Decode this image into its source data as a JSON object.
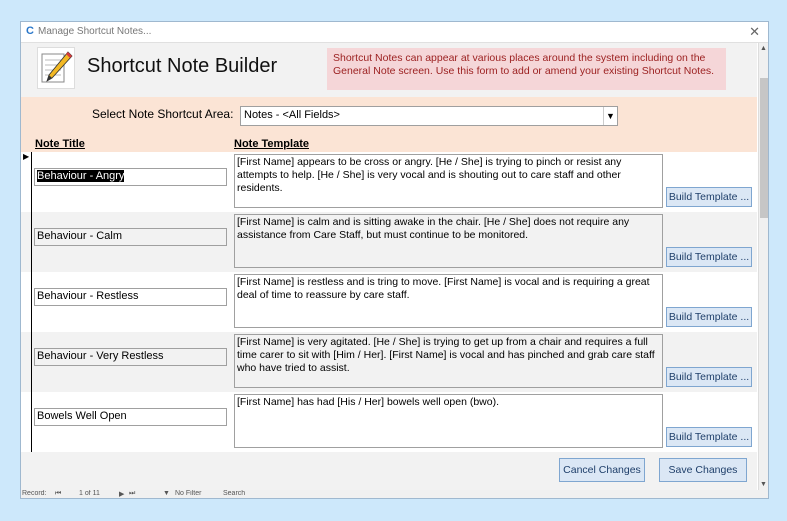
{
  "window": {
    "title": "Manage Shortcut Notes..."
  },
  "header": {
    "title": "Shortcut Note Builder",
    "note": "Shortcut Notes can appear at various places around the system including on the General Note screen.  Use this form to add or amend your existing Shortcut Notes."
  },
  "filter": {
    "label": "Select Note Shortcut Area:",
    "value": "Notes - <All Fields>"
  },
  "columns": {
    "title": "Note Title",
    "template": "Note Template"
  },
  "rows": [
    {
      "title": "Behaviour - Angry",
      "template": "[First Name] appears to be cross or angry. [He / She] is trying to pinch or resist any attempts to help. [He / She] is very vocal and is shouting out to care staff and other residents.",
      "button": "Build Template ..."
    },
    {
      "title": "Behaviour - Calm",
      "template": "[First Name] is calm and is sitting awake in the chair. [He / She] does not require any assistance from Care Staff, but must continue to be monitored.",
      "button": "Build Template ..."
    },
    {
      "title": "Behaviour - Restless",
      "template": "[First Name] is restless and is tring to move. [First Name] is vocal and is requiring a great deal of time to reassure by care staff.",
      "button": "Build Template ..."
    },
    {
      "title": "Behaviour - Very Restless",
      "template": "[First Name] is very agitated. [He / She] is trying to get up from a chair and requires a full time carer to sit with [Him / Her]. [First Name] is vocal and has pinched and grab care staff who have tried to assist.",
      "button": "Build Template ..."
    },
    {
      "title": "Bowels Well Open",
      "template": "[First Name] has had [His / Her] bowels well open (bwo).",
      "button": "Build Template ..."
    }
  ],
  "footer": {
    "cancel": "Cancel Changes",
    "save": "Save Changes"
  },
  "navbar": {
    "record_label": "Record:",
    "position": "1 of 11",
    "filter": "No Filter",
    "search": "Search"
  },
  "icons": [
    "app-icon",
    "close-icon",
    "pencil-notepad-icon",
    "chevron-down-icon",
    "record-selector-icon"
  ]
}
